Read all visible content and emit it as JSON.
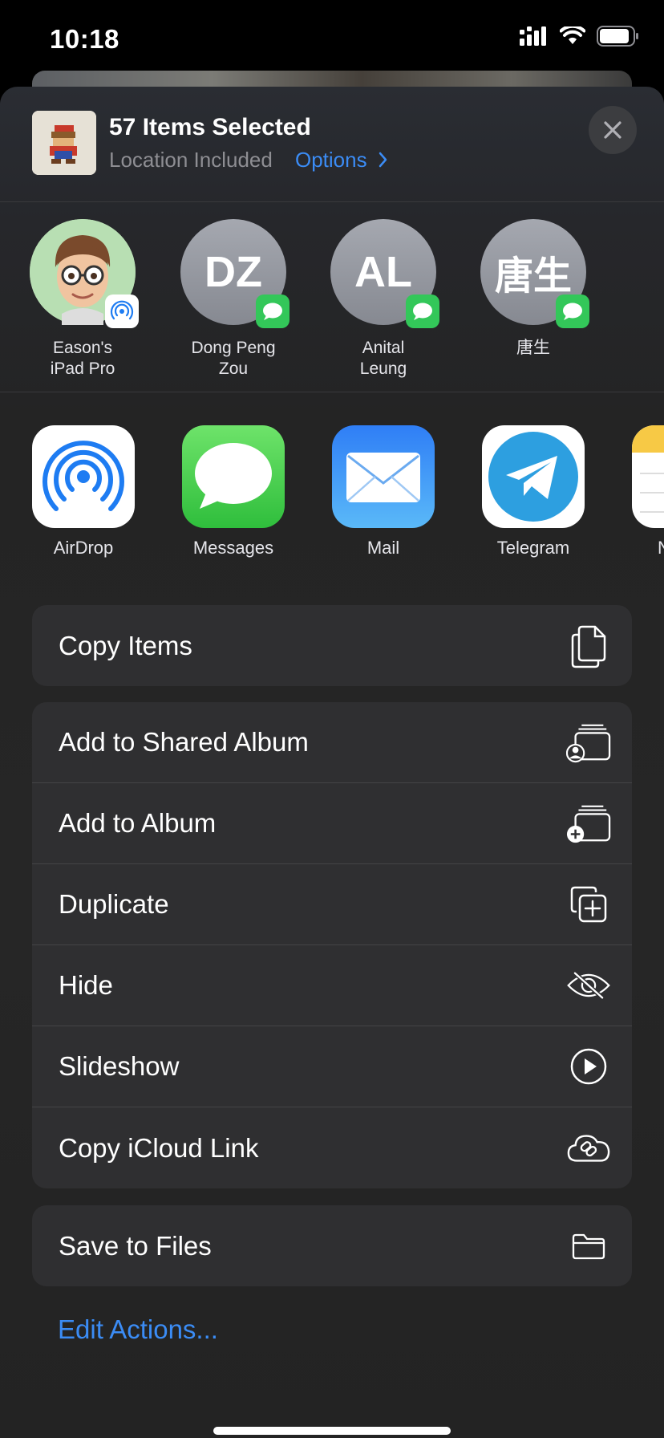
{
  "status_bar": {
    "time": "10:18"
  },
  "header": {
    "title": "57 Items Selected",
    "subtitle": "Location Included",
    "options_label": "Options"
  },
  "people": [
    {
      "name": "Eason's iPad Pro",
      "line1": "Eason's",
      "line2": "iPad Pro",
      "initials": "",
      "badge": "airdrop"
    },
    {
      "name": "Dong Peng Zou",
      "line1": "Dong Peng",
      "line2": "Zou",
      "initials": "DZ",
      "badge": "messages"
    },
    {
      "name": "Anital Leung",
      "line1": "Anital",
      "line2": "Leung",
      "initials": "AL",
      "badge": "messages"
    },
    {
      "name": "唐生",
      "line1": "唐生",
      "line2": "",
      "initials": "唐生",
      "badge": "messages"
    }
  ],
  "apps": [
    {
      "label": "AirDrop",
      "icon": "airdrop-icon"
    },
    {
      "label": "Messages",
      "icon": "messages-icon"
    },
    {
      "label": "Mail",
      "icon": "mail-icon"
    },
    {
      "label": "Telegram",
      "icon": "telegram-icon"
    },
    {
      "label": "N",
      "icon": "notes-icon"
    }
  ],
  "actions": {
    "group1": [
      {
        "label": "Copy Items",
        "icon": "copy-icon"
      }
    ],
    "group2": [
      {
        "label": "Add to Shared Album",
        "icon": "shared-album-icon"
      },
      {
        "label": "Add to Album",
        "icon": "add-album-icon"
      },
      {
        "label": "Duplicate",
        "icon": "duplicate-icon"
      },
      {
        "label": "Hide",
        "icon": "eye-slash-icon"
      },
      {
        "label": "Slideshow",
        "icon": "play-circle-icon"
      },
      {
        "label": "Copy iCloud Link",
        "icon": "cloud-link-icon"
      }
    ],
    "group3": [
      {
        "label": "Save to Files",
        "icon": "folder-icon"
      }
    ]
  },
  "edit_actions_label": "Edit Actions...",
  "colors": {
    "accent": "#3b8cf5",
    "messages_green": "#33c759",
    "sheet_bg": "#262626",
    "row_bg": "#2f2f31"
  }
}
